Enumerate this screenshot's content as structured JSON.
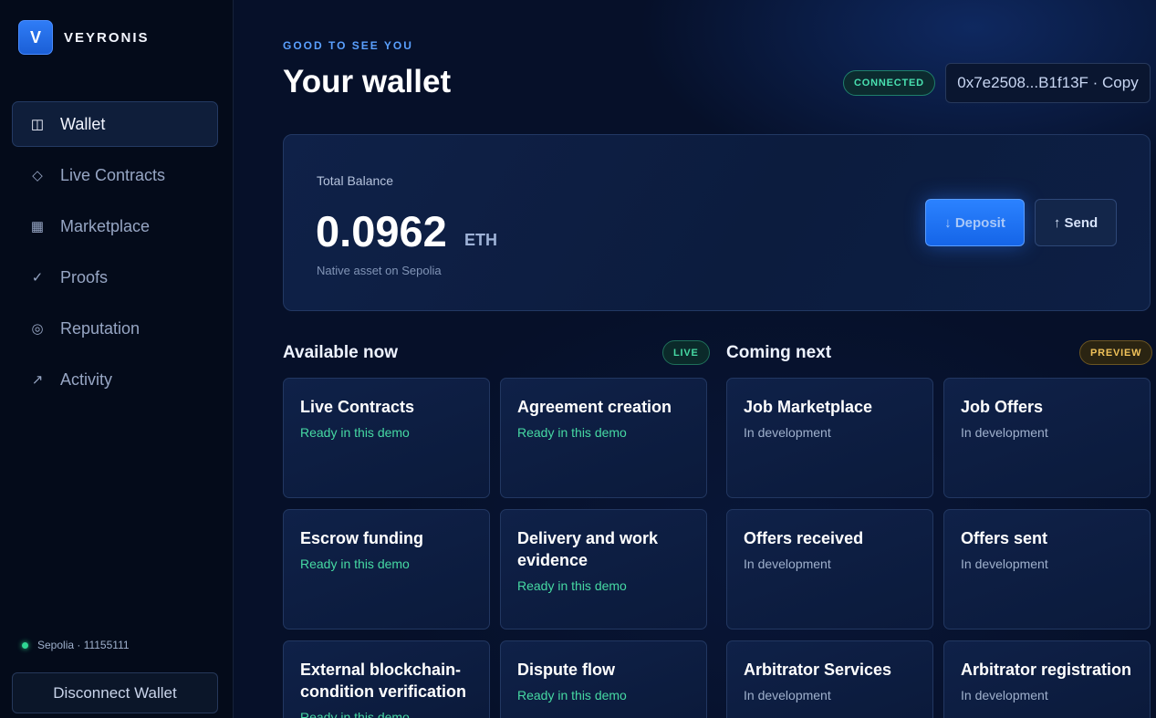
{
  "brand": {
    "logo_letter": "V",
    "name": "VEYRONIS"
  },
  "sidebar": {
    "items": [
      {
        "label": "Wallet",
        "icon": "◫",
        "icon_name": "wallet-icon",
        "active": true
      },
      {
        "label": "Live Contracts",
        "icon": "◇",
        "icon_name": "diamond-icon",
        "active": false
      },
      {
        "label": "Marketplace",
        "icon": "▦",
        "icon_name": "grid-icon",
        "active": false
      },
      {
        "label": "Proofs",
        "icon": "✓",
        "icon_name": "check-icon",
        "active": false
      },
      {
        "label": "Reputation",
        "icon": "◎",
        "icon_name": "target-icon",
        "active": false
      },
      {
        "label": "Activity",
        "icon": "↗",
        "icon_name": "trend-arrow-icon",
        "active": false
      }
    ],
    "network": "Sepolia · 11155111",
    "disconnect_label": "Disconnect Wallet"
  },
  "header": {
    "greeting": "GOOD TO SEE YOU",
    "title": "Your wallet",
    "status_badge": "CONNECTED",
    "address": "0x7e2508...B1f13F · Copy"
  },
  "balance": {
    "label": "Total Balance",
    "value": "0.0962",
    "unit": "ETH",
    "subtitle": "Native asset on Sepolia",
    "deposit_label": "↓ Deposit",
    "send_label": "↑ Send"
  },
  "available": {
    "title": "Available now",
    "badge": "LIVE",
    "cards": [
      {
        "title": "Live Contracts",
        "status": "Ready in this demo"
      },
      {
        "title": "Agreement creation",
        "status": "Ready in this demo"
      },
      {
        "title": "Escrow funding",
        "status": "Ready in this demo"
      },
      {
        "title": "Delivery and work evidence",
        "status": "Ready in this demo"
      },
      {
        "title": "External blockchain-condition verification",
        "status": "Ready in this demo"
      },
      {
        "title": "Dispute flow",
        "status": "Ready in this demo"
      }
    ]
  },
  "coming": {
    "title": "Coming next",
    "badge": "PREVIEW",
    "cards": [
      {
        "title": "Job Marketplace",
        "status": "In development"
      },
      {
        "title": "Job Offers",
        "status": "In development"
      },
      {
        "title": "Offers received",
        "status": "In development"
      },
      {
        "title": "Offers sent",
        "status": "In development"
      },
      {
        "title": "Arbitrator Services",
        "status": "In development"
      },
      {
        "title": "Arbitrator registration",
        "status": "In development"
      }
    ]
  },
  "colors": {
    "accent": "#2b82ff",
    "ready": "#46d9a3",
    "preview": "#f0c25a",
    "background": "#061029"
  }
}
